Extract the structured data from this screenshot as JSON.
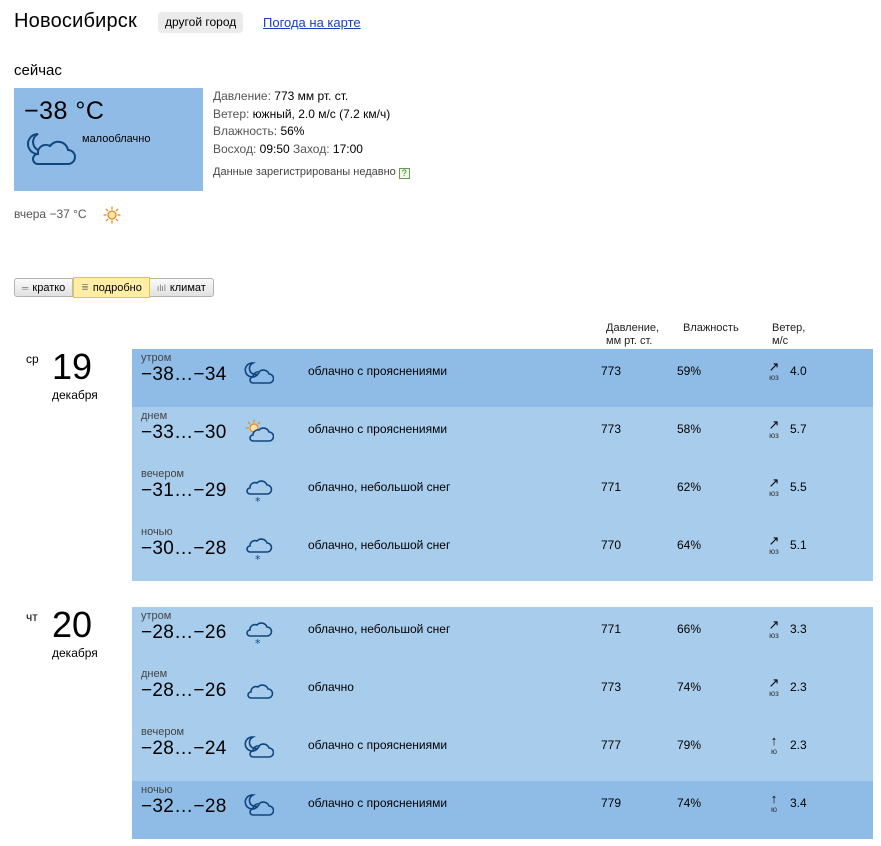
{
  "header": {
    "city": "Новосибирск",
    "other_city_label": "другой город",
    "map_link_label": "Погода на карте"
  },
  "now": {
    "label": "сейчас",
    "temp": "−38 °C",
    "condition": "малооблачно",
    "icon": "moon-cloud-icon",
    "details": {
      "pressure_label": "Давление:",
      "pressure_value": "773 мм рт. ст.",
      "wind_label": "Ветер:",
      "wind_value": "южный, 2.0 м/с (7.2 км/ч)",
      "humidity_label": "Влажность:",
      "humidity_value": "56%",
      "sunrise_label": "Восход:",
      "sunrise_value": "09:50",
      "sunset_label": "Заход:",
      "sunset_value": "17:00",
      "registered_note": "Данные зарегистрированы недавно",
      "help_mark": "?"
    },
    "yesterday": "вчера −37 °C"
  },
  "tabs": [
    {
      "label": "кратко",
      "icon": "lines-icon",
      "active": false
    },
    {
      "label": "подробно",
      "icon": "list-icon",
      "active": true
    },
    {
      "label": "климат",
      "icon": "bars-icon",
      "active": false
    }
  ],
  "columns": {
    "pressure_line1": "Давление,",
    "pressure_line2": "мм рт. ст.",
    "humidity": "Влажность",
    "wind_line1": "Ветер,",
    "wind_line2": "м/с"
  },
  "days": [
    {
      "dow": "ср",
      "num": "19",
      "month": "декабря",
      "rows": [
        {
          "part": "утром",
          "temp": "−38…−34",
          "icon": "moon-cloud-icon",
          "condition": "облачно с прояснениями",
          "pressure": "773",
          "humidity": "59%",
          "wind_arrow": "↗",
          "wind_dir": "юз",
          "wind_speed": "4.0",
          "shade": "dark"
        },
        {
          "part": "днем",
          "temp": "−33…−30",
          "icon": "sun-cloud-icon",
          "condition": "облачно с прояснениями",
          "pressure": "773",
          "humidity": "58%",
          "wind_arrow": "↗",
          "wind_dir": "юз",
          "wind_speed": "5.7",
          "shade": "light"
        },
        {
          "part": "вечером",
          "temp": "−31…−29",
          "icon": "snow-cloud-icon",
          "condition": "облачно, небольшой снег",
          "pressure": "771",
          "humidity": "62%",
          "wind_arrow": "↗",
          "wind_dir": "юз",
          "wind_speed": "5.5",
          "shade": "light"
        },
        {
          "part": "ночью",
          "temp": "−30…−28",
          "icon": "snow-cloud-icon",
          "condition": "облачно, небольшой снег",
          "pressure": "770",
          "humidity": "64%",
          "wind_arrow": "↗",
          "wind_dir": "юз",
          "wind_speed": "5.1",
          "shade": "light"
        }
      ]
    },
    {
      "dow": "чт",
      "num": "20",
      "month": "декабря",
      "rows": [
        {
          "part": "утром",
          "temp": "−28…−26",
          "icon": "snow-cloud-icon",
          "condition": "облачно, небольшой снег",
          "pressure": "771",
          "humidity": "66%",
          "wind_arrow": "↗",
          "wind_dir": "юз",
          "wind_speed": "3.3",
          "shade": "light"
        },
        {
          "part": "днем",
          "temp": "−28…−26",
          "icon": "cloud-icon",
          "condition": "облачно",
          "pressure": "773",
          "humidity": "74%",
          "wind_arrow": "↗",
          "wind_dir": "юз",
          "wind_speed": "2.3",
          "shade": "light"
        },
        {
          "part": "вечером",
          "temp": "−28…−24",
          "icon": "moon-cloud-icon",
          "condition": "облачно с прояснениями",
          "pressure": "777",
          "humidity": "79%",
          "wind_arrow": "↑",
          "wind_dir": "ю",
          "wind_speed": "2.3",
          "shade": "light"
        },
        {
          "part": "ночью",
          "temp": "−32…−28",
          "icon": "moon-cloud-icon",
          "condition": "облачно с прояснениями",
          "pressure": "779",
          "humidity": "74%",
          "wind_arrow": "↑",
          "wind_dir": "ю",
          "wind_speed": "3.4",
          "shade": "dark"
        }
      ]
    }
  ]
}
